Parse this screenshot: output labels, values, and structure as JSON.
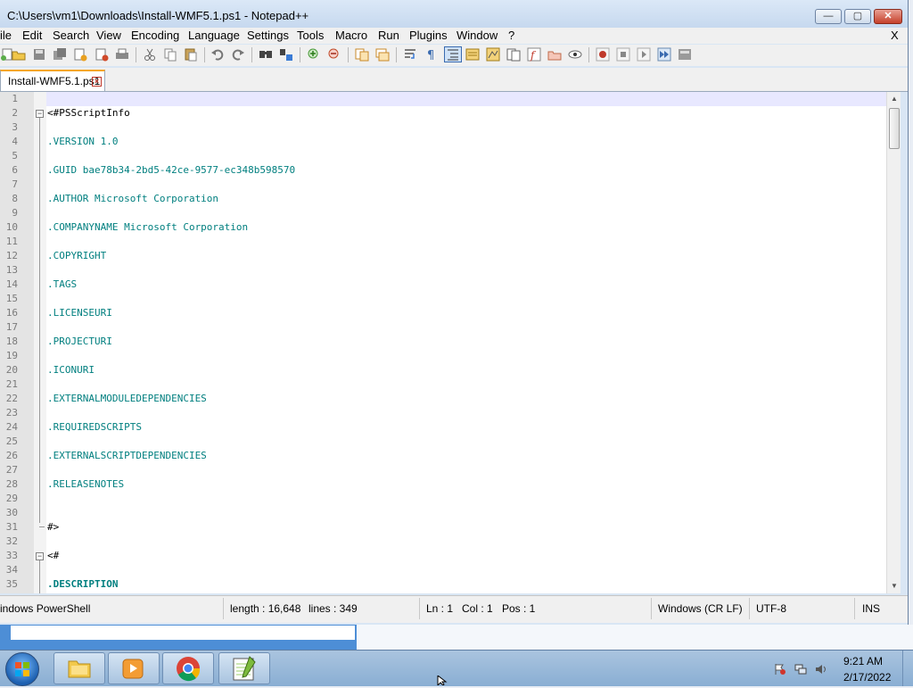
{
  "window": {
    "title": "C:\\Users\\vm1\\Downloads\\Install-WMF5.1.ps1 - Notepad++",
    "min_label": "—",
    "max_label": "▢",
    "close_label": "✕"
  },
  "menu": {
    "items": [
      "ile",
      "Edit",
      "Search",
      "View",
      "Encoding",
      "Language",
      "Settings",
      "Tools",
      "Macro",
      "Run",
      "Plugins",
      "Window",
      "?"
    ],
    "close_x": "X"
  },
  "tab": {
    "label": "Install-WMF5.1.ps1",
    "close": "×"
  },
  "lines": [
    {
      "n": "1",
      "t": ""
    },
    {
      "n": "2",
      "t": "<#PSScriptInfo"
    },
    {
      "n": "3",
      "t": ""
    },
    {
      "n": "4",
      "t": ".VERSION 1.0"
    },
    {
      "n": "5",
      "t": ""
    },
    {
      "n": "6",
      "t": ".GUID bae78b34-2bd5-42ce-9577-ec348b598570"
    },
    {
      "n": "7",
      "t": ""
    },
    {
      "n": "8",
      "t": ".AUTHOR Microsoft Corporation"
    },
    {
      "n": "9",
      "t": ""
    },
    {
      "n": "10",
      "t": ".COMPANYNAME Microsoft Corporation"
    },
    {
      "n": "11",
      "t": ""
    },
    {
      "n": "12",
      "t": ".COPYRIGHT"
    },
    {
      "n": "13",
      "t": ""
    },
    {
      "n": "14",
      "t": ".TAGS"
    },
    {
      "n": "15",
      "t": ""
    },
    {
      "n": "16",
      "t": ".LICENSEURI"
    },
    {
      "n": "17",
      "t": ""
    },
    {
      "n": "18",
      "t": ".PROJECTURI"
    },
    {
      "n": "19",
      "t": ""
    },
    {
      "n": "20",
      "t": ".ICONURI"
    },
    {
      "n": "21",
      "t": ""
    },
    {
      "n": "22",
      "t": ".EXTERNALMODULEDEPENDENCIES"
    },
    {
      "n": "23",
      "t": ""
    },
    {
      "n": "24",
      "t": ".REQUIREDSCRIPTS"
    },
    {
      "n": "25",
      "t": ""
    },
    {
      "n": "26",
      "t": ".EXTERNALSCRIPTDEPENDENCIES"
    },
    {
      "n": "27",
      "t": ""
    },
    {
      "n": "28",
      "t": ".RELEASENOTES"
    },
    {
      "n": "29",
      "t": ""
    },
    {
      "n": "30",
      "t": ""
    },
    {
      "n": "31",
      "t": "#>"
    },
    {
      "n": "32",
      "t": ""
    },
    {
      "n": "33",
      "t": "<#"
    },
    {
      "n": "34",
      "t": ""
    },
    {
      "n": "35",
      "t": ".DESCRIPTION"
    }
  ],
  "status": {
    "language": "indows PowerShell",
    "length": "length : 16,648",
    "lines": "lines : 349",
    "ln": "Ln : 1",
    "col": "Col : 1",
    "pos": "Pos : 1",
    "eol": "Windows (CR LF)",
    "encoding": "UTF-8",
    "mode": "INS"
  },
  "taskbar": {
    "apps": [
      "file-explorer-icon",
      "media-player-icon",
      "chrome-icon",
      "notepadpp-icon"
    ],
    "time": "9:21 AM",
    "date": "2/17/2022"
  },
  "colors": {
    "code": "#007f7f",
    "current_line": "#e8e8ff",
    "tab_accent": "#f5a623"
  }
}
